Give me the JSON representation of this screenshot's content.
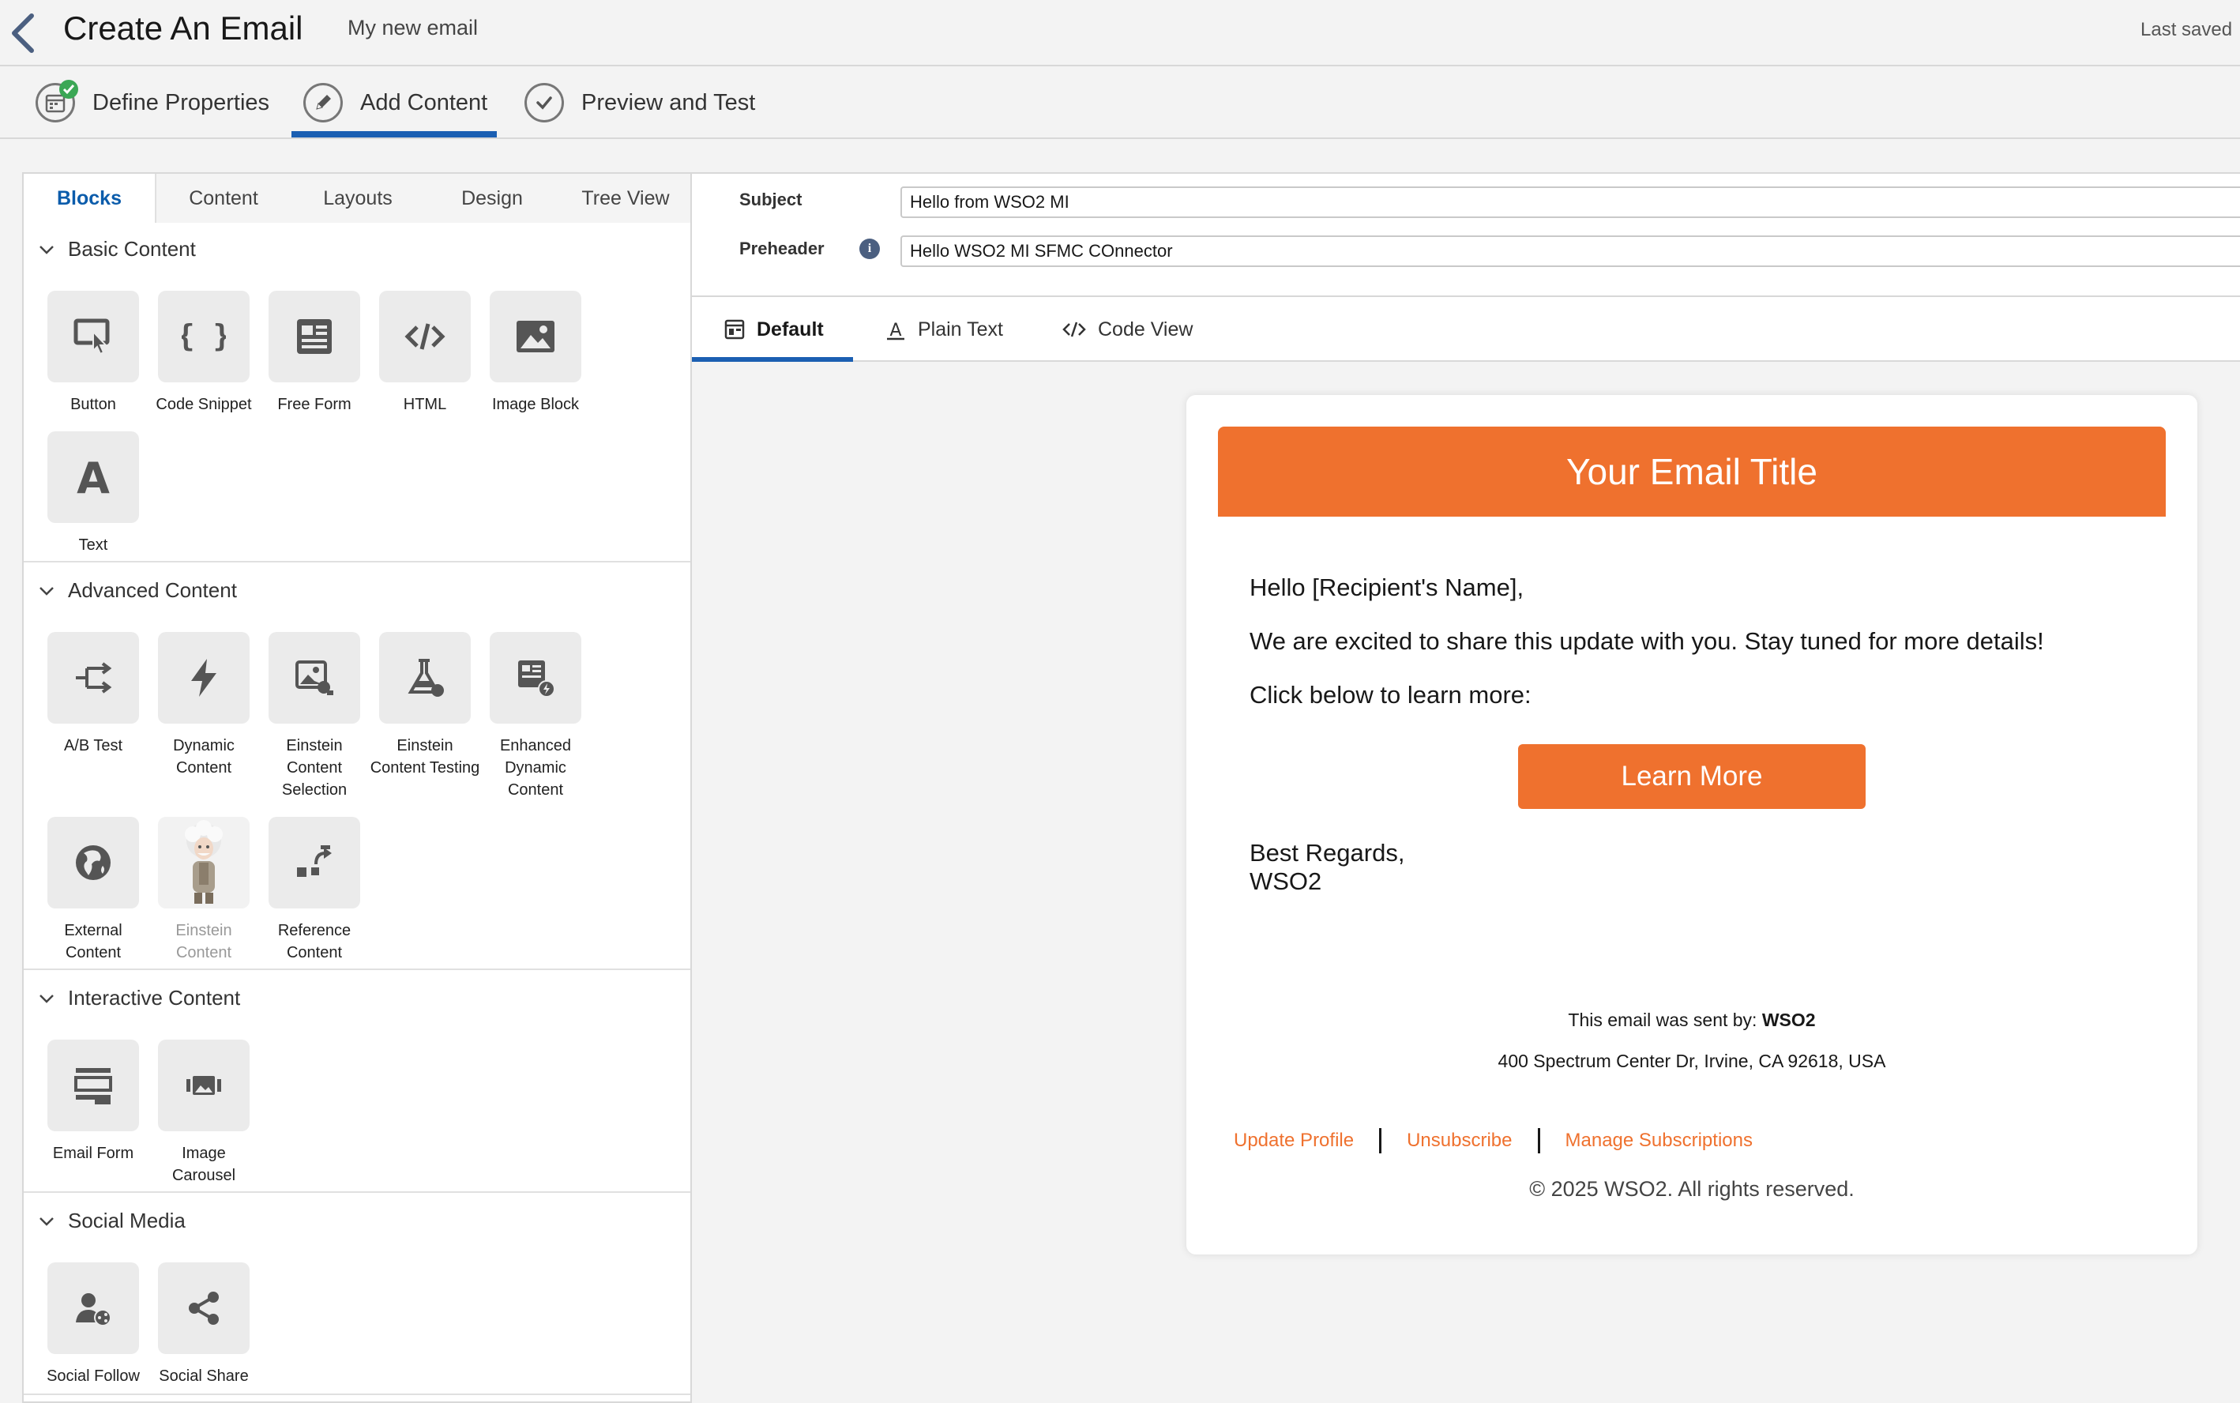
{
  "header": {
    "title": "Create An Email",
    "subtitle": "My new email",
    "last_saved": "Last saved"
  },
  "stepper": {
    "steps": [
      {
        "label": "Define Properties",
        "icon": "calendar-check-icon",
        "completed": true
      },
      {
        "label": "Add Content",
        "icon": "pencil-icon",
        "active": true
      },
      {
        "label": "Preview and Test",
        "icon": "checkmark-icon"
      }
    ]
  },
  "left_tabs": [
    "Blocks",
    "Content",
    "Layouts",
    "Design",
    "Tree View"
  ],
  "sections": {
    "basic": {
      "title": "Basic Content",
      "blocks": [
        {
          "label": "Button",
          "icon": "button-icon"
        },
        {
          "label": "Code Snippet",
          "icon": "code-snippet-icon"
        },
        {
          "label": "Free Form",
          "icon": "free-form-icon"
        },
        {
          "label": "HTML",
          "icon": "html-icon"
        },
        {
          "label": "Image Block",
          "icon": "image-icon"
        },
        {
          "label": "Text",
          "icon": "text-icon"
        }
      ]
    },
    "advanced": {
      "title": "Advanced Content",
      "blocks": [
        {
          "label": "A/B Test",
          "icon": "ab-test-icon"
        },
        {
          "label": "Dynamic Content",
          "icon": "lightning-icon"
        },
        {
          "label": "Einstein Content Selection",
          "icon": "einstein-selection-icon"
        },
        {
          "label": "Einstein Content Testing",
          "icon": "flask-icon"
        },
        {
          "label": "Enhanced Dynamic Content",
          "icon": "enhanced-dynamic-icon"
        },
        {
          "label": "External Content",
          "icon": "globe-icon"
        },
        {
          "label": "Einstein Content",
          "icon": "einstein-character-icon",
          "disabled": true
        },
        {
          "label": "Reference Content",
          "icon": "reference-icon"
        }
      ]
    },
    "interactive": {
      "title": "Interactive Content",
      "blocks": [
        {
          "label": "Email Form",
          "icon": "form-icon"
        },
        {
          "label": "Image Carousel",
          "icon": "carousel-icon"
        }
      ]
    },
    "social": {
      "title": "Social Media",
      "blocks": [
        {
          "label": "Social Follow",
          "icon": "social-follow-icon"
        },
        {
          "label": "Social Share",
          "icon": "share-icon"
        }
      ]
    }
  },
  "meta": {
    "subject_label": "Subject",
    "subject_value": "Hello from WSO2 MI",
    "preheader_label": "Preheader",
    "preheader_value": "Hello WSO2 MI SFMC COnnector"
  },
  "view_tabs": [
    {
      "label": "Default",
      "icon": "layout-icon",
      "active": true
    },
    {
      "label": "Plain Text",
      "icon": "text-a-icon"
    },
    {
      "label": "Code View",
      "icon": "code-icon"
    }
  ],
  "email": {
    "title": "Your Email Title",
    "greeting": "Hello [Recipient's Name],",
    "body1": "We are excited to share this update with you. Stay tuned for more details!",
    "body2": "Click below to learn more:",
    "button": "Learn More",
    "signoff": "Best Regards,",
    "signature": "WSO2",
    "sent_by_prefix": "This email was sent by: ",
    "sent_by_name": "WSO2",
    "address": "400 Spectrum Center Dr, Irvine, CA 92618, USA",
    "links": [
      "Update Profile",
      "Unsubscribe",
      "Manage Subscriptions"
    ],
    "copyright": "© 2025 WSO2. All rights reserved."
  },
  "colors": {
    "brand_orange": "#ef712e",
    "accent_blue": "#1b5fb2",
    "tab_active_blue": "#0b5cab"
  }
}
